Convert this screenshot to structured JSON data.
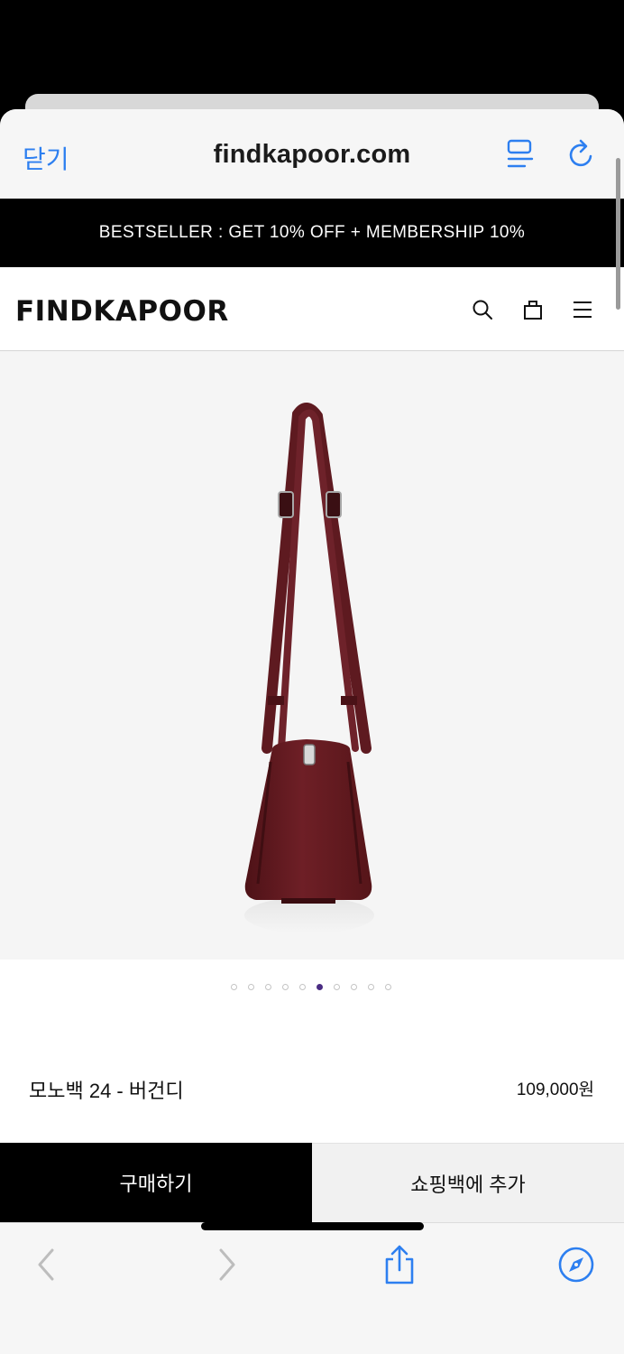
{
  "browser": {
    "close_label": "닫기",
    "url": "findkapoor.com",
    "reader_icon": "reader-icon",
    "reload_icon": "reload-icon"
  },
  "promo": {
    "text": "BESTSELLER : GET 10% OFF + MEMBERSHIP 10%"
  },
  "header": {
    "logo": "FINDKAPOOR",
    "icons": [
      "search-icon",
      "shopping-bag-icon",
      "menu-icon"
    ]
  },
  "gallery": {
    "total_images": 10,
    "active_index": 5
  },
  "product": {
    "name": "모노백 24 - 버건디",
    "price": "109,000원",
    "color": "#6b1e24"
  },
  "actions": {
    "buy_label": "구매하기",
    "cart_label": "쇼핑백에 추가"
  },
  "toolbar": {
    "icons": [
      "back-icon",
      "forward-icon",
      "share-icon",
      "compass-icon"
    ]
  },
  "colors": {
    "ios_blue": "#2d7ff0",
    "active_dot": "#4a2d83"
  }
}
